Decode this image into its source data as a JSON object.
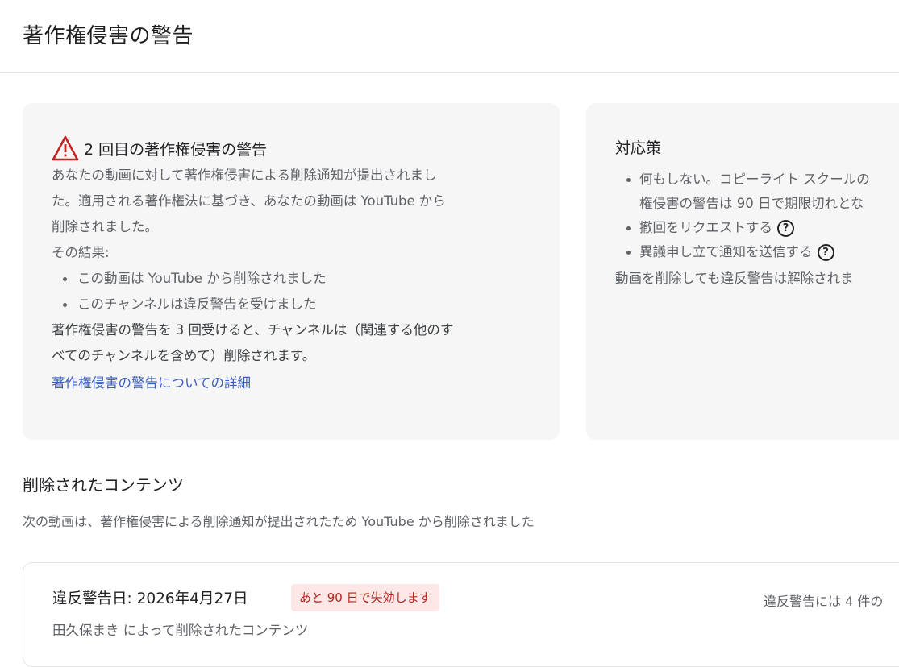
{
  "page": {
    "title": "著作権侵害の警告"
  },
  "warning_card": {
    "heading": "2 回目の著作権侵害の警告",
    "intro_line1": "あなたの動画に対して著作権侵害による削除通知が提出されまし",
    "intro_line2": "た。適用される著作権法に基づき、あなたの動画は YouTube から",
    "intro_line3": "削除されました。",
    "result_label": "その結果:",
    "results": [
      "この動画は YouTube から削除されました",
      "このチャンネルは違反警告を受けました"
    ],
    "consequence_line1": "著作権侵害の警告を 3 回受けると、チャンネルは（関連する他のす",
    "consequence_line2": "べてのチャンネルを含めて）削除されます。",
    "details_link": "著作権侵害の警告についての詳細"
  },
  "actions_card": {
    "title": "対応策",
    "item1_line1": "何もしない。コピーライト スクールの",
    "item1_line2": "権侵害の警告は 90 日で期限切れとな",
    "item2": "撤回をリクエストする",
    "item3": "異議申し立て通知を送信する",
    "note": "動画を削除しても違反警告は解除されま",
    "help_glyph": "?"
  },
  "removed_content": {
    "title": "削除されたコンテンツ",
    "description": "次の動画は、著作権侵害による削除通知が提出されたため YouTube から削除されました"
  },
  "strike": {
    "date_label": "違反警告日: 2026年4月27日",
    "expiry_badge": "あと 90 日で失効します",
    "right_text": "違反警告には 4 件の",
    "removed_by": "田久保まき によって削除されたコンテンツ"
  },
  "colors": {
    "warning_icon": "#c5221f",
    "link": "#3c5fbd",
    "badge_bg": "#fde7e7",
    "badge_text": "#b3261e"
  },
  "icons": {
    "warning": "warning-triangle-icon",
    "help": "help-circle-icon"
  }
}
